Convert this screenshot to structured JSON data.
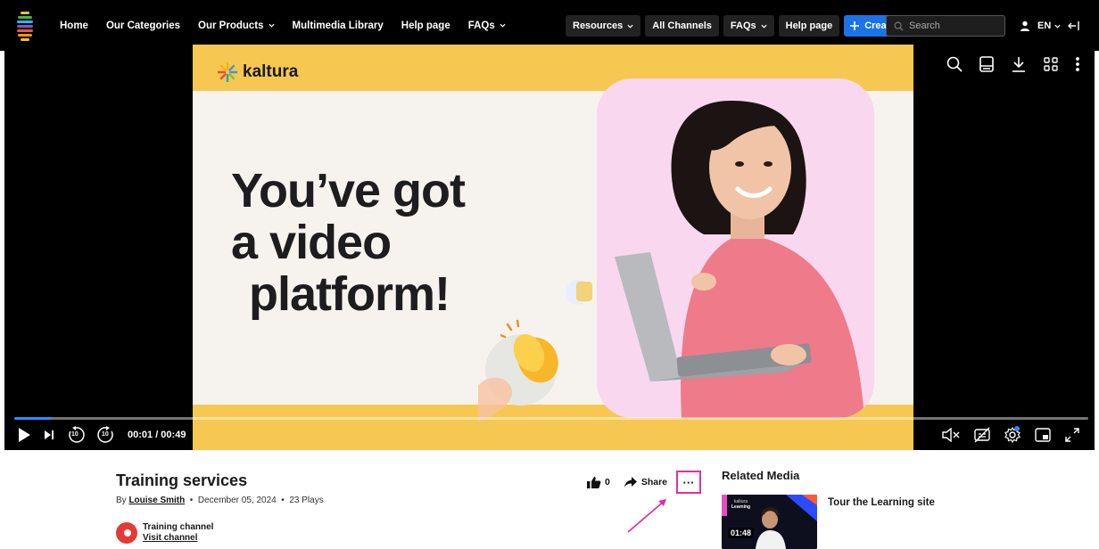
{
  "nav": {
    "links": [
      {
        "label": "Home",
        "dropdown": false
      },
      {
        "label": "Our Categories",
        "dropdown": false
      },
      {
        "label": "Our Products",
        "dropdown": true
      },
      {
        "label": "Multimedia Library",
        "dropdown": false
      },
      {
        "label": "Help page",
        "dropdown": false
      },
      {
        "label": "FAQs",
        "dropdown": true
      }
    ],
    "pills": {
      "resources": "Resources",
      "all_channels": "All Channels",
      "faqs": "FAQs",
      "help_page": "Help page",
      "create": "Create"
    },
    "search_placeholder": "Search",
    "language": "EN"
  },
  "player": {
    "slide": {
      "brand": "kaltura",
      "headline_1": "You’ve got",
      "headline_2": "a video",
      "headline_3": "platform!"
    },
    "time_display": "00:01 / 00:49",
    "progress": 0.035,
    "rewind_seconds": "10",
    "forward_seconds": "10",
    "accent_color": "#2e8bff"
  },
  "media": {
    "title": "Training services",
    "by_prefix": "By",
    "author": "Louise Smith",
    "date": "December 05, 2024",
    "plays": "23 Plays",
    "channel_name": "Training channel",
    "visit_channel": "Visit channel",
    "likes": "0",
    "share_label": "Share",
    "more_label": "···"
  },
  "related": {
    "heading": "Related Media",
    "items": [
      {
        "title": "Tour the Learning site",
        "duration": "01:48",
        "thumb_brand": "kaltura",
        "thumb_caption": "Learning"
      }
    ]
  }
}
